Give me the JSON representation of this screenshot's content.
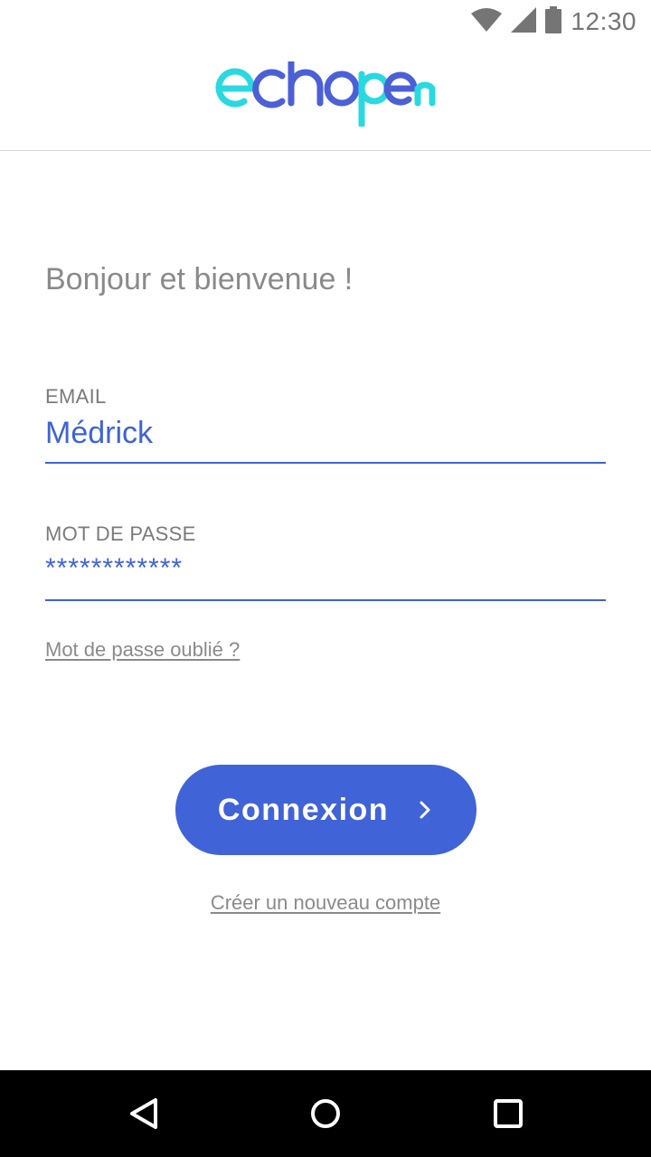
{
  "status_bar": {
    "time": "12:30",
    "icons": [
      "wifi-icon",
      "cellular-signal-icon",
      "battery-icon"
    ]
  },
  "header": {
    "logo_text": "echopen",
    "logo_colors": [
      "#4b5fd6",
      "#2ad9e0"
    ]
  },
  "main": {
    "welcome": "Bonjour et bienvenue !",
    "email": {
      "label": "EMAIL",
      "value": "Médrick"
    },
    "password": {
      "label": "MOT DE PASSE",
      "value": "************"
    },
    "forgot_link": "Mot de passe oublié ?",
    "login_button": {
      "label": "Connexion",
      "icon": "chevron-right-icon"
    },
    "create_account_link": "Créer un nouveau compte"
  },
  "nav_bar": {
    "icons": [
      "back-icon",
      "home-icon",
      "recents-icon"
    ]
  },
  "colors": {
    "accent": "#4163d8",
    "field_text": "#3f63d4",
    "muted_text": "#8a8a8a"
  }
}
